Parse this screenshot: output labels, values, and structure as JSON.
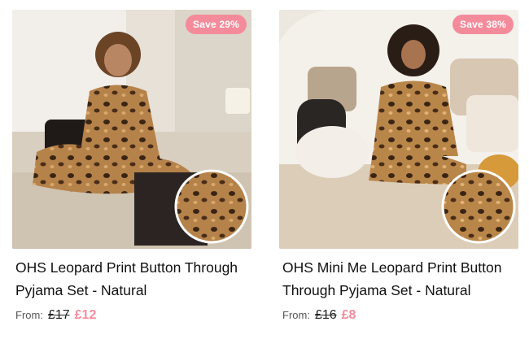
{
  "products": [
    {
      "badge": "Save 29%",
      "title": "OHS Leopard Print Button Through Pyjama Set - Natural",
      "price_prefix": "From:",
      "was_price": "£17",
      "now_price": "£12"
    },
    {
      "badge": "Save 38%",
      "title": "OHS Mini Me Leopard Print Button Through Pyjama Set - Natural",
      "price_prefix": "From:",
      "was_price": "£16",
      "now_price": "£8"
    }
  ],
  "colors": {
    "accent": "#f48b9b",
    "text": "#111111",
    "muted": "#555555"
  },
  "icons": [
    "leopard-swatch-icon"
  ]
}
